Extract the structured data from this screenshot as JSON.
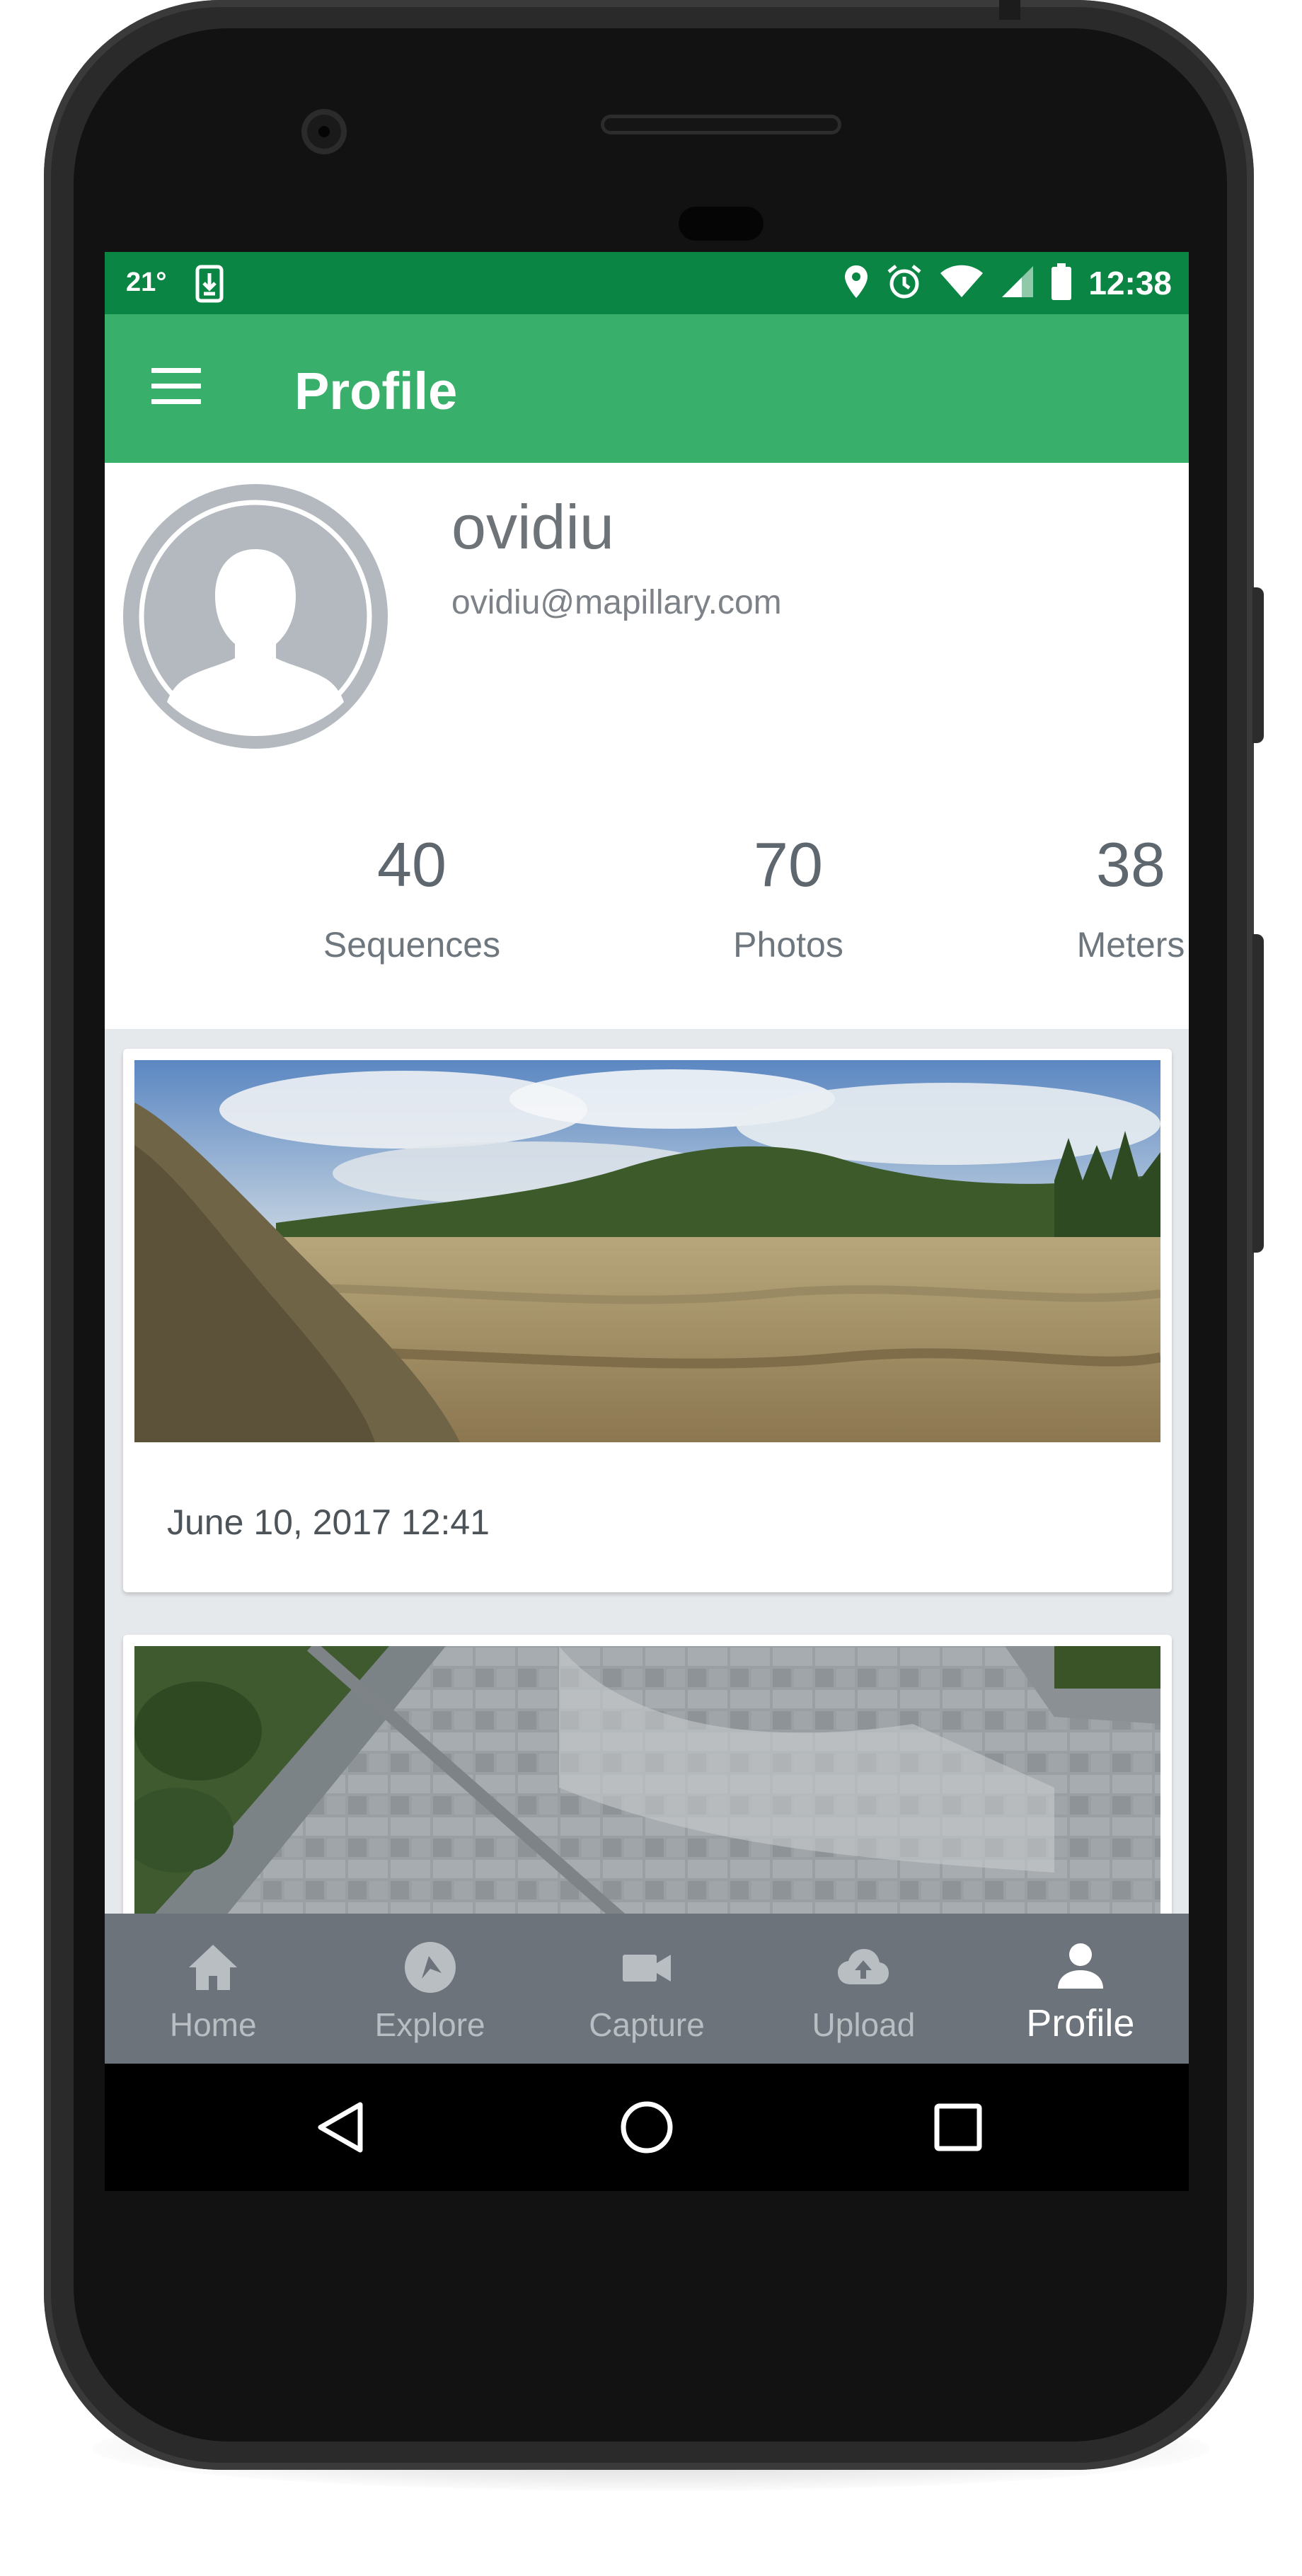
{
  "status_bar": {
    "temperature": "21°",
    "time": "12:38",
    "icons": [
      "download-icon",
      "location-icon",
      "alarm-icon",
      "wifi-icon",
      "signal-icon",
      "battery-icon"
    ]
  },
  "app_bar": {
    "title": "Profile",
    "menu_icon": "menu-icon"
  },
  "profile": {
    "username": "ovidiu",
    "email": "ovidiu@mapillary.com",
    "avatar_icon": "user-silhouette-icon",
    "stats": [
      {
        "value": "40",
        "label": "Sequences"
      },
      {
        "value": "70",
        "label": "Photos"
      },
      {
        "value": "38",
        "label": "Meters"
      }
    ]
  },
  "sequences": [
    {
      "date": "June 10, 2017 12:41",
      "image": "landscape-photo"
    },
    {
      "date": "",
      "image": "paved-walkway-photo"
    }
  ],
  "bottom_nav": {
    "items": [
      {
        "label": "Home",
        "icon": "home-icon",
        "active": false
      },
      {
        "label": "Explore",
        "icon": "compass-icon",
        "active": false
      },
      {
        "label": "Capture",
        "icon": "video-camera-icon",
        "active": false
      },
      {
        "label": "Upload",
        "icon": "cloud-upload-icon",
        "active": false
      },
      {
        "label": "Profile",
        "icon": "person-icon",
        "active": true
      }
    ]
  },
  "system_nav": {
    "icons": [
      "back-icon",
      "home-circle-icon",
      "recents-icon"
    ]
  },
  "colors": {
    "status_bar": "#0b8543",
    "app_bar": "#38af6b",
    "bottom_nav": "#6c737b",
    "avatar": "#b3b9bf"
  }
}
